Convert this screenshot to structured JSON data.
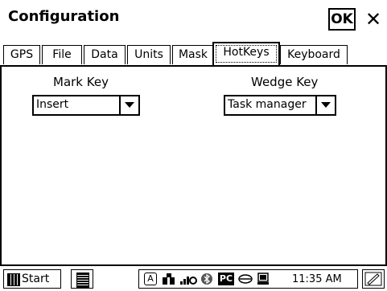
{
  "window": {
    "title": "Configuration",
    "ok_label": "OK",
    "close_label": "✕"
  },
  "tabs": [
    {
      "label": "GPS"
    },
    {
      "label": "File"
    },
    {
      "label": "Data"
    },
    {
      "label": "Units"
    },
    {
      "label": "Mask"
    },
    {
      "label": "HotKeys",
      "active": true
    },
    {
      "label": "Keyboard"
    }
  ],
  "hotkeys": {
    "mark_key_label": "Mark Key",
    "mark_key_value": "Insert",
    "wedge_key_label": "Wedge Key",
    "wedge_key_value": "Task manager"
  },
  "taskbar": {
    "start_label": "Start",
    "clock": "11:35 AM",
    "tray_icons": [
      "input-a-icon",
      "network-icon",
      "signal-icon",
      "bluetooth-icon",
      "pc-icon",
      "sync-icon",
      "device-icon"
    ]
  }
}
